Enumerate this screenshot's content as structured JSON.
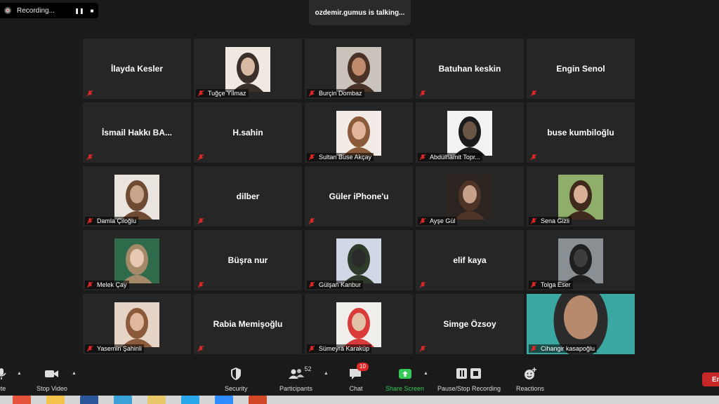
{
  "recording": {
    "label": "Recording...",
    "pause": "❚❚",
    "stop": "■"
  },
  "talking": "ozdemir.gumus is talking...",
  "right_edge_text": "",
  "tiles": [
    {
      "name": "İlayda Kesler",
      "label": "",
      "photo": false
    },
    {
      "name": "",
      "label": "Tuğçe Yılmaz",
      "photo": true,
      "colors": [
        "#efe9e2",
        "#3b2f2a",
        "#d7b9a4"
      ]
    },
    {
      "name": "",
      "label": "Burçin Dombaz",
      "photo": true,
      "colors": [
        "#c9c3bb",
        "#4a3326",
        "#c08a6c"
      ]
    },
    {
      "name": "Batuhan keskin",
      "label": "",
      "photo": false
    },
    {
      "name": "Engin Senol",
      "label": "",
      "photo": false
    },
    {
      "name": "İsmail  Hakkı  BA...",
      "label": "",
      "photo": false
    },
    {
      "name": "H.sahin",
      "label": "",
      "photo": false
    },
    {
      "name": "",
      "label": "Sultan Buse Akçay",
      "photo": true,
      "colors": [
        "#f3ece6",
        "#8a5a3a",
        "#e0b59a"
      ]
    },
    {
      "name": "",
      "label": "Abdülhamit Topr...",
      "photo": true,
      "colors": [
        "#f2f2f2",
        "#1b1b1b",
        "#6b5646"
      ]
    },
    {
      "name": "buse kumbiloğlu",
      "label": "",
      "photo": false
    },
    {
      "name": "",
      "label": "Damla Çiloğlu",
      "photo": true,
      "colors": [
        "#e9e4de",
        "#6e4a32",
        "#c9a48a"
      ]
    },
    {
      "name": "dilber",
      "label": "",
      "photo": false
    },
    {
      "name": "Güler iPhone'u",
      "label": "",
      "photo": false
    },
    {
      "name": "",
      "label": "Ayşe Gül",
      "photo": true,
      "colors": [
        "#2c2420",
        "#4d3426",
        "#c7a08a"
      ]
    },
    {
      "name": "",
      "label": "Sena Gizli",
      "photo": true,
      "colors": [
        "#8fae6a",
        "#3f2a1d",
        "#d9b095"
      ]
    },
    {
      "name": "",
      "label": "Melek Çay",
      "photo": true,
      "colors": [
        "#2e6b4a",
        "#a58a6a",
        "#e7c9b2"
      ]
    },
    {
      "name": "Büşra nur",
      "label": "",
      "photo": false
    },
    {
      "name": "",
      "label": "Gülşan Kanbur",
      "photo": true,
      "colors": [
        "#cfd8e4",
        "#2f3b2a",
        "#2a2a2a"
      ]
    },
    {
      "name": "elif kaya",
      "label": "",
      "photo": false
    },
    {
      "name": "",
      "label": "Tolga Eser",
      "photo": true,
      "colors": [
        "#8a8f93",
        "#1f1f1f",
        "#3d3d3d"
      ]
    },
    {
      "name": "",
      "label": "Yasemin Şahinli",
      "photo": true,
      "colors": [
        "#e6d5c6",
        "#8a5a3a",
        "#e0b89d"
      ]
    },
    {
      "name": "Rabia Memişoğlu",
      "label": "",
      "photo": false
    },
    {
      "name": "",
      "label": "Sümeyra Karaküp",
      "photo": true,
      "colors": [
        "#f1efec",
        "#d93a3a",
        "#e3c0a8"
      ]
    },
    {
      "name": "Simge Özsoy",
      "label": "",
      "photo": false
    },
    {
      "name": "",
      "label": "Cihangir kasapoğlu",
      "photo": true,
      "wide": true,
      "colors": [
        "#3aa7a0",
        "#2b2b2b",
        "#b78a6e"
      ]
    }
  ],
  "toolbar": {
    "mute": "ute",
    "stop_video": "Stop Video",
    "security": "Security",
    "participants": "Participants",
    "participants_count": "52",
    "chat": "Chat",
    "chat_badge": "10",
    "share_screen": "Share Screen",
    "pause_stop_recording": "Pause/Stop Recording",
    "reactions": "Reactions",
    "end": "En"
  },
  "colors": {
    "accent_green": "#35c957",
    "end_red": "#c62828",
    "mute_red": "#e02828"
  }
}
